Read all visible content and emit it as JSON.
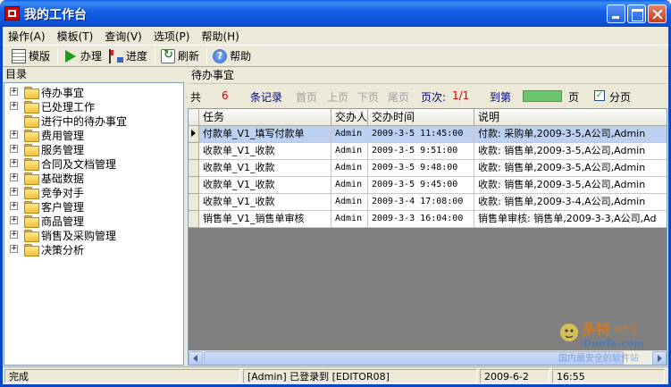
{
  "window": {
    "title": "我的工作台"
  },
  "menu": [
    {
      "label": "操作(A)"
    },
    {
      "label": "模板(T)"
    },
    {
      "label": "查询(V)"
    },
    {
      "label": "选项(P)"
    },
    {
      "label": "帮助(H)"
    }
  ],
  "toolbar": {
    "template_label": "模版",
    "process_label": "办理",
    "progress_label": "进度",
    "refresh_label": "刷新",
    "help_label": "帮助"
  },
  "sidebar": {
    "title": "目录",
    "items": [
      {
        "label": "待办事宜",
        "expandable": true
      },
      {
        "label": "已处理工作",
        "expandable": true
      },
      {
        "label": "进行中的待办事宜",
        "expandable": false
      },
      {
        "label": "费用管理",
        "expandable": true
      },
      {
        "label": "服务管理",
        "expandable": true
      },
      {
        "label": "合同及文档管理",
        "expandable": true
      },
      {
        "label": "基础数据",
        "expandable": true
      },
      {
        "label": "竞争对手",
        "expandable": true
      },
      {
        "label": "客户管理",
        "expandable": true
      },
      {
        "label": "商品管理",
        "expandable": true
      },
      {
        "label": "销售及采购管理",
        "expandable": true
      },
      {
        "label": "决策分析",
        "expandable": true
      }
    ]
  },
  "main": {
    "title": "待办事宜",
    "pager": {
      "total_prefix": "共",
      "count": "6",
      "records_label": "条记录",
      "first": "首页",
      "prev": "上页",
      "next": "下页",
      "last": "尾页",
      "page_label": "页次:",
      "page_value": "1/1",
      "goto_label": "到第",
      "page_suffix": "页",
      "paging_label": "分页",
      "paging_checked": "✓"
    },
    "columns": [
      "任务",
      "交办人",
      "交办时间",
      "说明"
    ],
    "rows": [
      {
        "task": "付款单_V1_填写付款单",
        "assigner": "Admin",
        "time": "2009-3-5 11:45:00",
        "note": "付款: 采购单,2009-3-5,A公司,Admin"
      },
      {
        "task": "收款单_V1_收款",
        "assigner": "Admin",
        "time": "2009-3-5 9:51:00",
        "note": "收款: 销售单,2009-3-5,A公司,Admin"
      },
      {
        "task": "收款单_V1_收款",
        "assigner": "Admin",
        "time": "2009-3-5 9:48:00",
        "note": "收款: 销售单,2009-3-5,A公司,Admin"
      },
      {
        "task": "收款单_V1_收款",
        "assigner": "Admin",
        "time": "2009-3-5 9:45:00",
        "note": "收款: 销售单,2009-3-5,A公司,Admin"
      },
      {
        "task": "收款单_V1_收款",
        "assigner": "Admin",
        "time": "2009-3-4 17:08:00",
        "note": "收款: 销售单,2009-3-4,A公司,Admin"
      },
      {
        "task": "销售单_V1_销售单审核",
        "assigner": "Admin",
        "time": "2009-3-3 16:04:00",
        "note": "销售单审核: 销售单,2009-3-3,A公司,Ad"
      }
    ]
  },
  "status": {
    "state": "完成",
    "login": "[Admin]  已登录到 [EDITOR08]",
    "date": "2009-6-2",
    "time": "16:55"
  }
}
